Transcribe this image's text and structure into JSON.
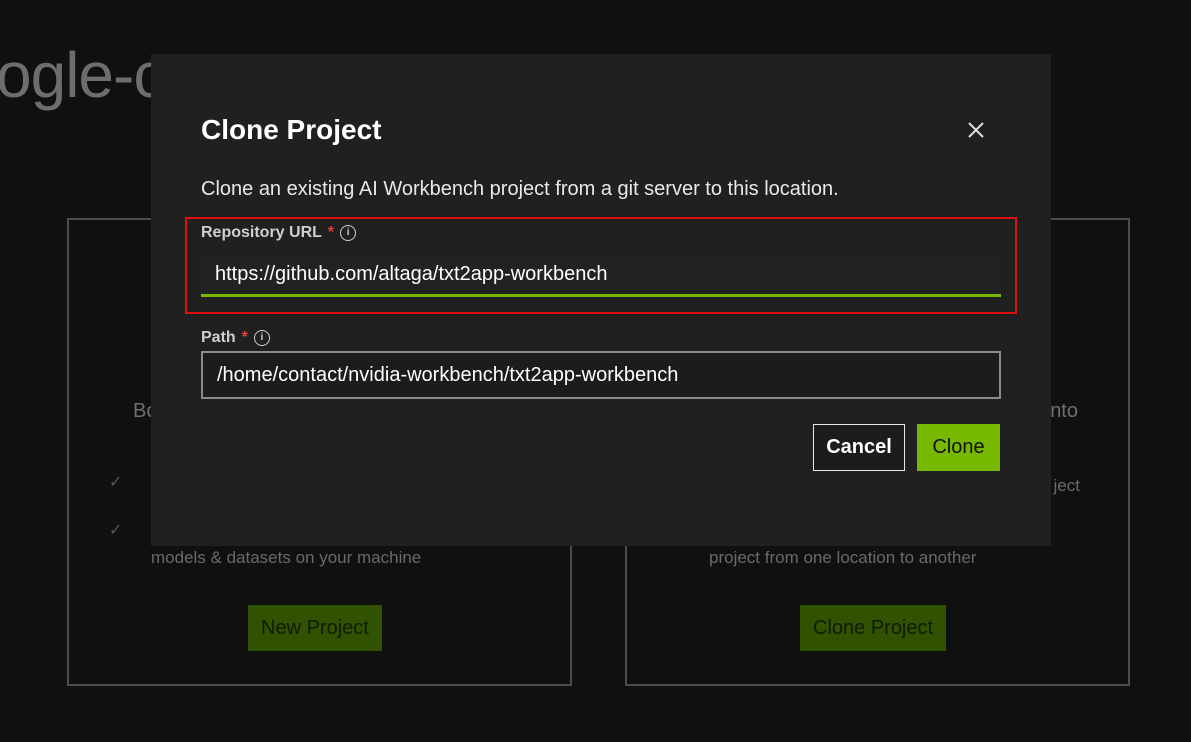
{
  "background": {
    "title_fragment": "ogle-c",
    "left_card": {
      "heading_fragment": "Bo",
      "text_line": "models & datasets on your machine",
      "button_label": "New Project"
    },
    "right_card": {
      "heading_fragment": "nto",
      "text_fragment": "ject",
      "text_line": "project from one location to another",
      "button_label": "Clone Project"
    }
  },
  "modal": {
    "title": "Clone Project",
    "close_icon": "close-icon",
    "description": "Clone an existing AI Workbench project from a git server to this location.",
    "repo_field": {
      "label": "Repository URL",
      "required_marker": "*",
      "info_icon": "ⓘ",
      "value": "https://github.com/altaga/txt2app-workbench"
    },
    "path_field": {
      "label": "Path",
      "required_marker": "*",
      "info_icon": "ⓘ",
      "value": "/home/contact/nvidia-workbench/txt2app-workbench"
    },
    "cancel_label": "Cancel",
    "clone_label": "Clone"
  },
  "colors": {
    "accent": "#76b900",
    "highlight": "#e01010",
    "modal_bg": "#202020",
    "page_bg": "#101010"
  }
}
